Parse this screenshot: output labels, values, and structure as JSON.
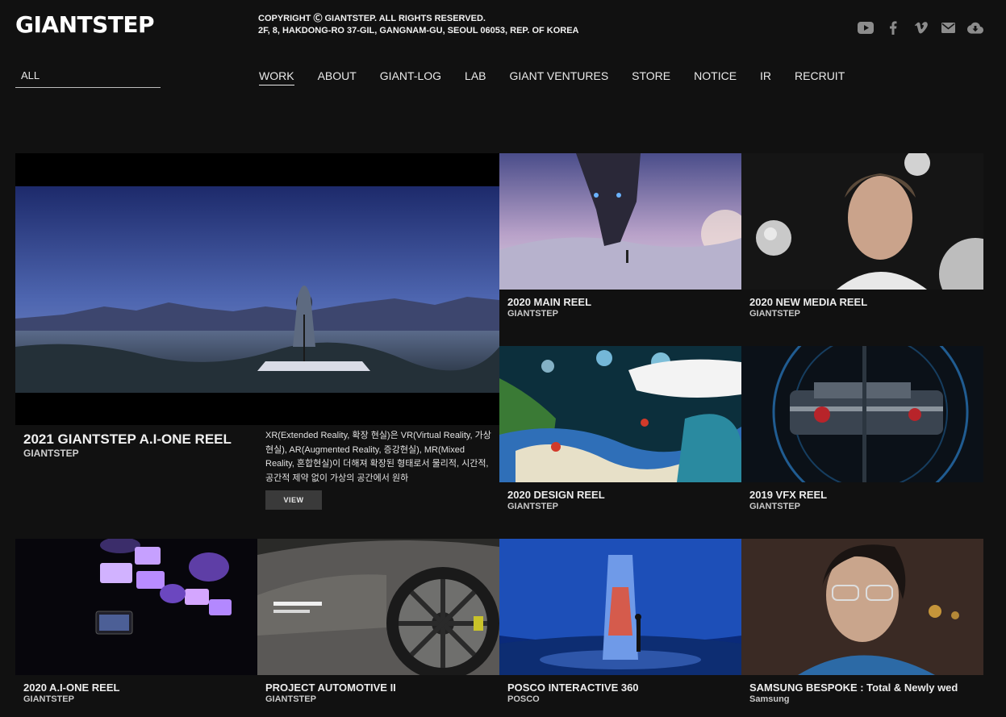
{
  "header": {
    "logo": "GIANTSTEP",
    "copyright_line1": "COPYRIGHT Ⓒ GIANTSTEP. ALL RIGHTS RESERVED.",
    "copyright_line2": "2F, 8, HAKDONG-RO 37-GIL, GANGNAM-GU, SEOUL 06053, REP. OF KOREA",
    "social_icons": [
      "youtube-icon",
      "facebook-icon",
      "vimeo-icon",
      "mail-icon",
      "cloud-download-icon"
    ]
  },
  "filter": {
    "selected": "ALL"
  },
  "nav": {
    "items": [
      "WORK",
      "ABOUT",
      "GIANT-LOG",
      "LAB",
      "GIANT VENTURES",
      "STORE",
      "NOTICE",
      "IR",
      "RECRUIT"
    ],
    "active": "WORK"
  },
  "featured": {
    "title": "2021 GIANTSTEP A.I-ONE REEL",
    "client": "GIANTSTEP",
    "description": "XR(Extended Reality, 확장 현실)은 VR(Virtual Reality, 가상현실), AR(Augmented Reality, 증강현실), MR(Mixed Reality, 혼합현실)이 더해져 확장된 형태로서 물리적, 시간적, 공간적 제약 없이 가상의 공간에서 원하",
    "view_label": "VIEW"
  },
  "works": [
    {
      "title": "2020 MAIN REEL",
      "client": "GIANTSTEP"
    },
    {
      "title": "2020 NEW MEDIA REEL",
      "client": "GIANTSTEP"
    },
    {
      "title": "2020 DESIGN REEL",
      "client": "GIANTSTEP"
    },
    {
      "title": "2019 VFX REEL",
      "client": "GIANTSTEP"
    },
    {
      "title": "2020 A.I-ONE REEL",
      "client": "GIANTSTEP"
    },
    {
      "title": "PROJECT AUTOMOTIVE II",
      "client": "GIANTSTEP"
    },
    {
      "title": "POSCO INTERACTIVE 360",
      "client": "POSCO"
    },
    {
      "title": "SAMSUNG BESPOKE : Total & Newly wed",
      "client": "Samsung"
    }
  ],
  "colors": {
    "background": "#111111",
    "text": "#e6e6e6",
    "button": "#3a3a3a",
    "icon": "#8c8c8c"
  }
}
